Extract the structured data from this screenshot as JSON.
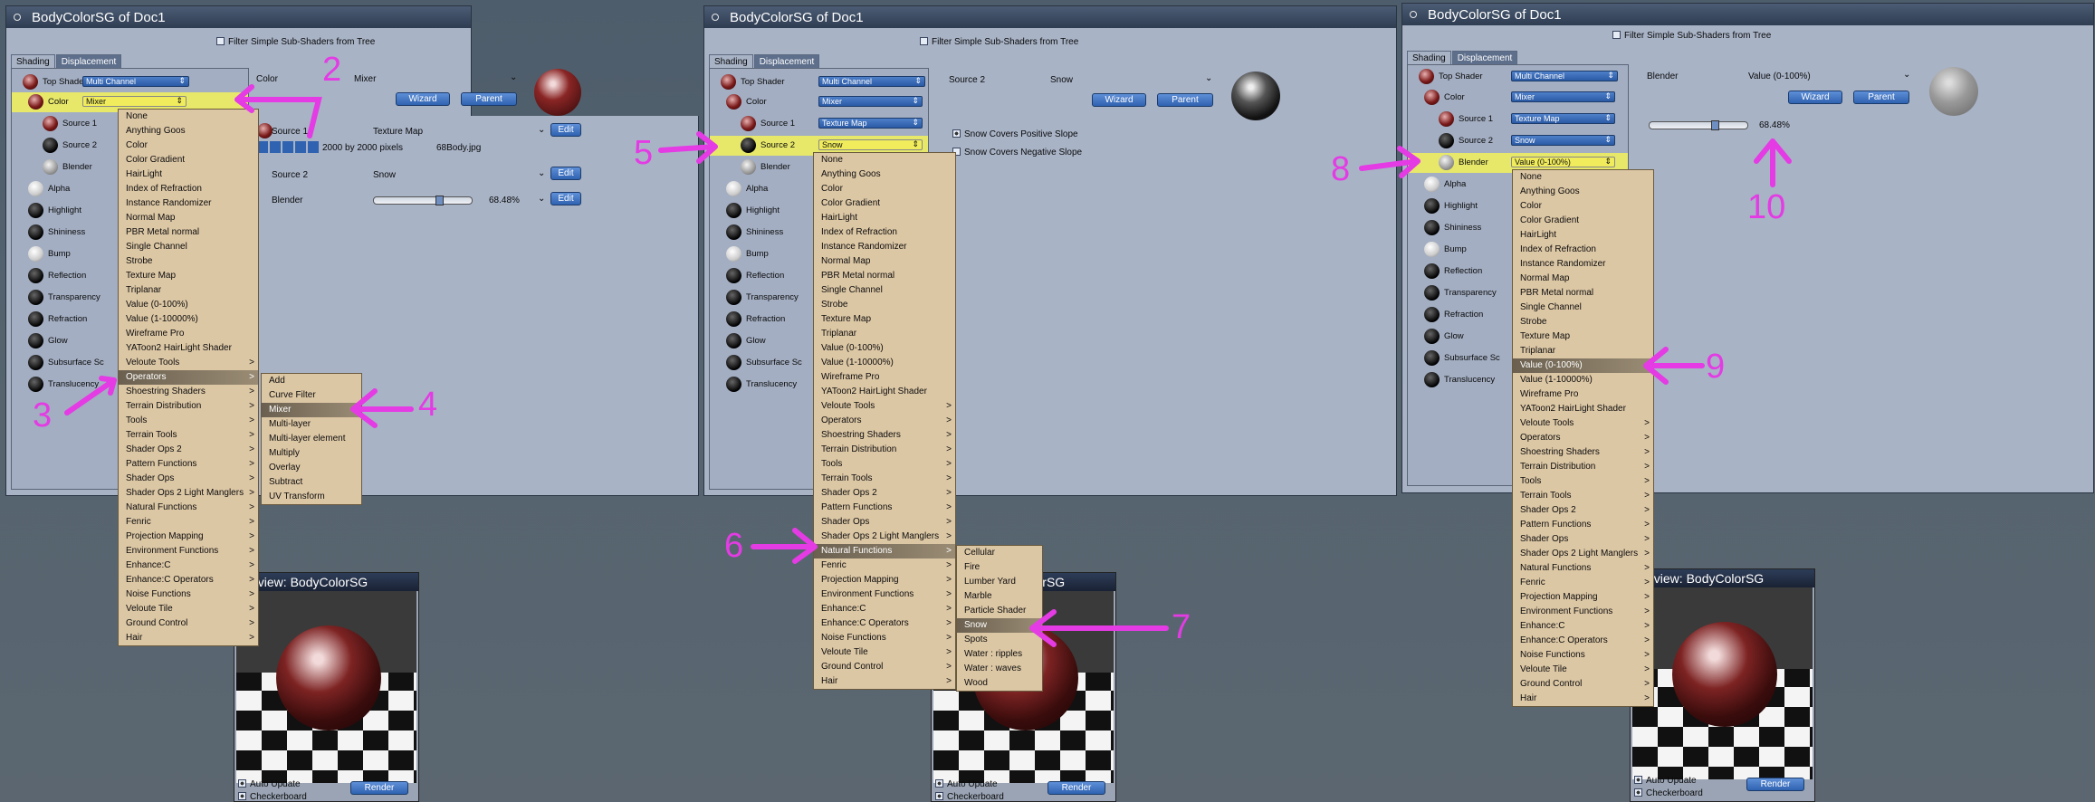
{
  "panels": [
    {
      "title": "BodyColorSG of Doc1",
      "filter": "Filter Simple Sub-Shaders from Tree",
      "tabs": [
        "Shading",
        "Displacement"
      ],
      "tree": [
        {
          "label": "Top Shader",
          "value": "Multi Channel"
        },
        {
          "label": "Color",
          "value": "Mixer"
        },
        {
          "label": "Source 1"
        },
        {
          "label": "Source 2"
        },
        {
          "label": "Blender"
        },
        {
          "label": "Alpha"
        },
        {
          "label": "Highlight"
        },
        {
          "label": "Shininess"
        },
        {
          "label": "Bump"
        },
        {
          "label": "Reflection"
        },
        {
          "label": "Transparency"
        },
        {
          "label": "Refraction"
        },
        {
          "label": "Glow"
        },
        {
          "label": "Subsurface Sc"
        },
        {
          "label": "Translucency"
        }
      ],
      "head": {
        "name": "Color",
        "type": "Mixer"
      },
      "wizard": "Wizard",
      "parent": "Parent",
      "props": [
        {
          "name": "Source 1",
          "value": "Texture Map"
        },
        {
          "name": "Source 2",
          "value": "Snow"
        },
        {
          "name": "Blender",
          "value": "68.48%"
        }
      ],
      "tex_size": "2000 by 2000 pixels",
      "tex_file": "68Body.jpg",
      "edit": "Edit"
    },
    {
      "title": "BodyColorSG of Doc1",
      "filter": "Filter Simple Sub-Shaders from Tree",
      "tabs": [
        "Shading",
        "Displacement"
      ],
      "tree": [
        {
          "label": "Top Shader",
          "value": "Multi Channel"
        },
        {
          "label": "Color",
          "value": "Mixer"
        },
        {
          "label": "Source 1",
          "value": "Texture Map"
        },
        {
          "label": "Source 2",
          "value": "Snow"
        },
        {
          "label": "Blender"
        },
        {
          "label": "Alpha"
        },
        {
          "label": "Highlight"
        },
        {
          "label": "Shininess"
        },
        {
          "label": "Bump"
        },
        {
          "label": "Reflection"
        },
        {
          "label": "Transparency"
        },
        {
          "label": "Refraction"
        },
        {
          "label": "Glow"
        },
        {
          "label": "Subsurface Sc"
        },
        {
          "label": "Translucency"
        }
      ],
      "head": {
        "name": "Source 2",
        "type": "Snow"
      },
      "wizard": "Wizard",
      "parent": "Parent",
      "opts": [
        "Snow Covers Positive Slope",
        "Snow Covers Negative Slope"
      ]
    },
    {
      "title": "BodyColorSG of Doc1",
      "filter": "Filter Simple Sub-Shaders from Tree",
      "tabs": [
        "Shading",
        "Displacement"
      ],
      "tree": [
        {
          "label": "Top Shader",
          "value": "Multi Channel"
        },
        {
          "label": "Color",
          "value": "Mixer"
        },
        {
          "label": "Source 1",
          "value": "Texture Map"
        },
        {
          "label": "Source 2",
          "value": "Snow"
        },
        {
          "label": "Blender",
          "value": "Value (0-100%)"
        },
        {
          "label": "Alpha"
        },
        {
          "label": "Highlight"
        },
        {
          "label": "Shininess"
        },
        {
          "label": "Bump"
        },
        {
          "label": "Reflection"
        },
        {
          "label": "Transparency"
        },
        {
          "label": "Refraction"
        },
        {
          "label": "Glow"
        },
        {
          "label": "Subsurface Sc"
        },
        {
          "label": "Translucency"
        }
      ],
      "head": {
        "name": "Blender",
        "type": "Value (0-100%)"
      },
      "wizard": "Wizard",
      "parent": "Parent",
      "slider_value": "68.48%"
    }
  ],
  "menus": {
    "m1": [
      "None",
      "Anything Goos",
      "Color",
      "Color Gradient",
      "HairLight",
      "Index of Refraction",
      "Instance Randomizer",
      "Normal Map",
      "PBR Metal normal",
      "Single Channel",
      "Strobe",
      "Texture Map",
      "Triplanar",
      "Value (0-100%)",
      "Value (1-10000%)",
      "Wireframe Pro",
      "YAToon2 HairLight Shader",
      "Veloute Tools",
      "Operators",
      "Shoestring Shaders",
      "Terrain Distribution",
      "Tools",
      "Terrain Tools",
      "Shader Ops 2",
      "Pattern Functions",
      "Shader Ops",
      "Shader Ops 2 Light Manglers",
      "Natural Functions",
      "Fenric",
      "Projection Mapping",
      "Environment Functions",
      "Enhance:C",
      "Enhance:C Operators",
      "Noise Functions",
      "Veloute Tile",
      "Ground Control",
      "Hair"
    ],
    "m1sub": [
      "Add",
      "Curve Filter",
      "Mixer",
      "Multi-layer",
      "Multi-layer element",
      "Multiply",
      "Overlay",
      "Subtract",
      "UV Transform"
    ],
    "m2": [
      "None",
      "Anything Goos",
      "Color",
      "Color Gradient",
      "HairLight",
      "Index of Refraction",
      "Instance Randomizer",
      "Normal Map",
      "PBR Metal normal",
      "Single Channel",
      "Strobe",
      "Texture Map",
      "Triplanar",
      "Value (0-100%)",
      "Value (1-10000%)",
      "Wireframe Pro",
      "YAToon2 HairLight Shader",
      "Veloute Tools",
      "Operators",
      "Shoestring Shaders",
      "Terrain Distribution",
      "Tools",
      "Terrain Tools",
      "Shader Ops 2",
      "Pattern Functions",
      "Shader Ops",
      "Shader Ops 2 Light Manglers",
      "Natural Functions",
      "Fenric",
      "Projection Mapping",
      "Environment Functions",
      "Enhance:C",
      "Enhance:C Operators",
      "Noise Functions",
      "Veloute Tile",
      "Ground Control",
      "Hair"
    ],
    "m2sub": [
      "Cellular",
      "Fire",
      "Lumber Yard",
      "Marble",
      "Particle Shader",
      "Snow",
      "Spots",
      "Water : ripples",
      "Water : waves",
      "Wood"
    ],
    "m3": [
      "None",
      "Anything Goos",
      "Color",
      "Color Gradient",
      "HairLight",
      "Index of Refraction",
      "Instance Randomizer",
      "Normal Map",
      "PBR Metal normal",
      "Single Channel",
      "Strobe",
      "Texture Map",
      "Triplanar",
      "Value (0-100%)",
      "Value (1-10000%)",
      "Wireframe Pro",
      "YAToon2 HairLight Shader",
      "Veloute Tools",
      "Operators",
      "Shoestring Shaders",
      "Terrain Distribution",
      "Tools",
      "Terrain Tools",
      "Shader Ops 2",
      "Pattern Functions",
      "Shader Ops",
      "Shader Ops 2 Light Manglers",
      "Natural Functions",
      "Fenric",
      "Projection Mapping",
      "Environment Functions",
      "Enhance:C",
      "Enhance:C Operators",
      "Noise Functions",
      "Veloute Tile",
      "Ground Control",
      "Hair"
    ]
  },
  "submenu_items": [
    "Veloute Tools",
    "Operators",
    "Shoestring Shaders",
    "Terrain Distribution",
    "Tools",
    "Terrain Tools",
    "Shader Ops 2",
    "Pattern Functions",
    "Shader Ops",
    "Shader Ops 2 Light Manglers",
    "Natural Functions",
    "Fenric",
    "Projection Mapping",
    "Environment Functions",
    "Enhance:C",
    "Enhance:C Operators",
    "Noise Functions",
    "Veloute Tile",
    "Ground Control",
    "Hair"
  ],
  "preview": {
    "title": "Preview: BodyColorSG",
    "auto": "Auto Update",
    "checker": "Checkerboard",
    "render": "Render"
  },
  "annotations": [
    "2",
    "3",
    "4",
    "5",
    "6",
    "7",
    "8",
    "9",
    "10"
  ],
  "colors": {
    "annotation": "#e43be4",
    "menu": "#dcc7a5",
    "highlight_row": "#e7e86a",
    "panel": "#a8b3c6",
    "button": "#2f62b0"
  }
}
